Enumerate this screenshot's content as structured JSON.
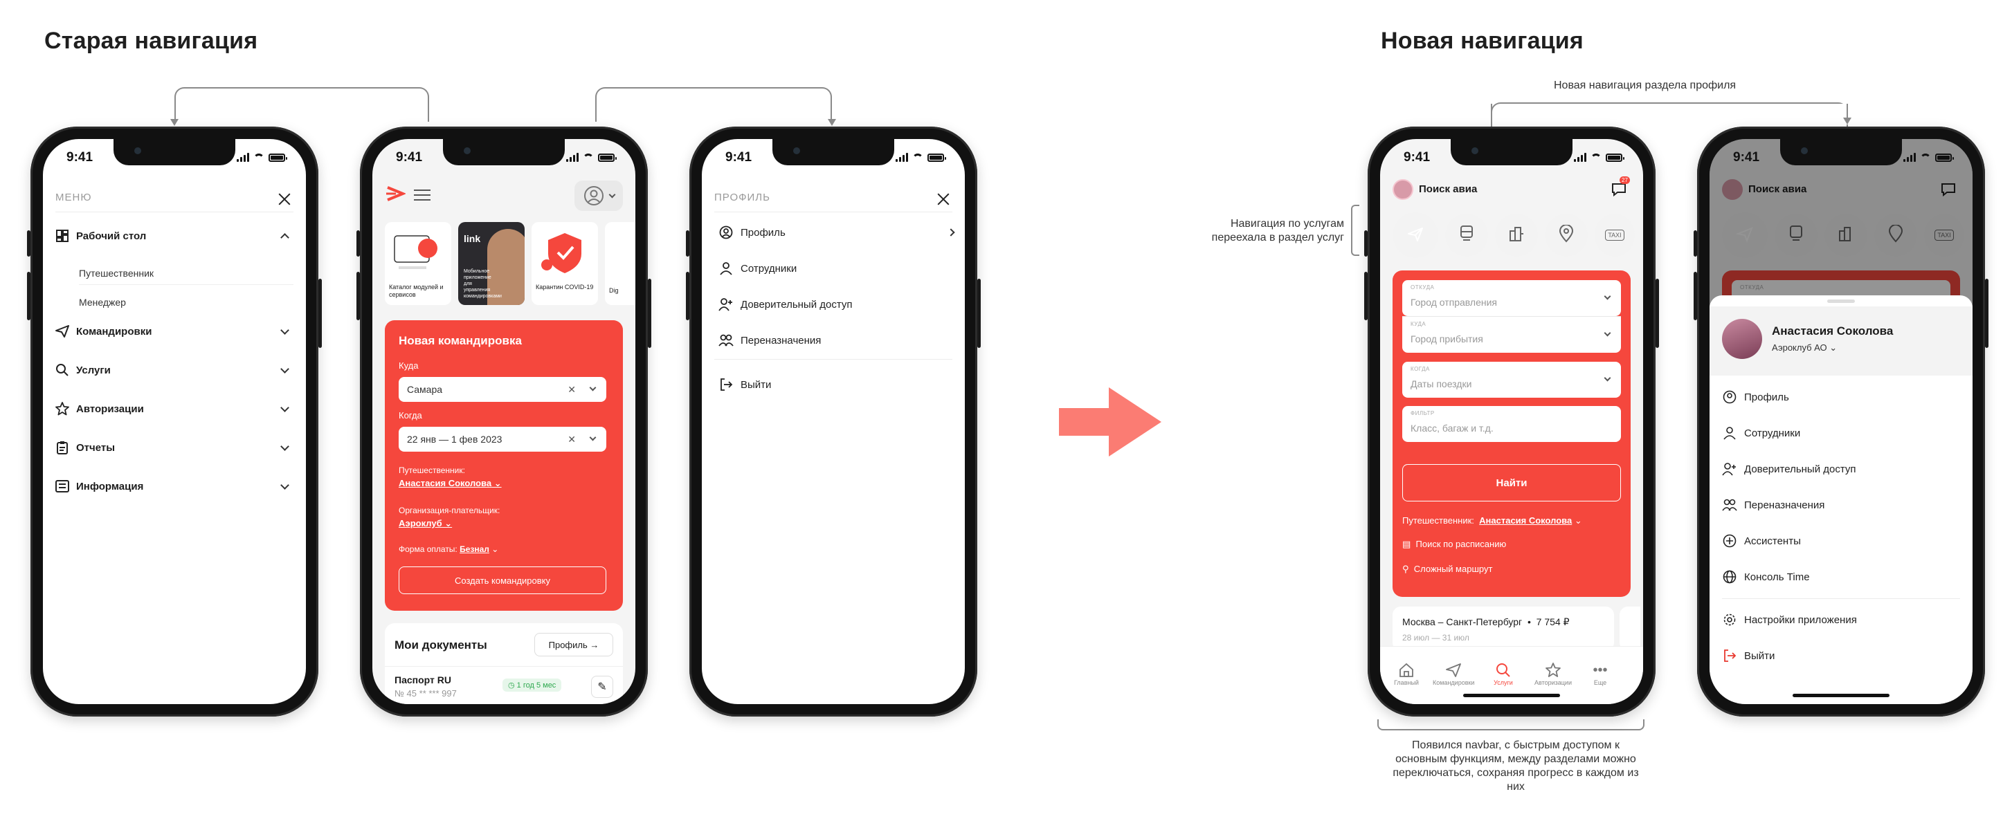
{
  "old_title": "Старая навигация",
  "new_title": "Новая навигация",
  "status_time": "9:41",
  "colors": {
    "accent": "#f5473d",
    "arrow": "#fb7c73"
  },
  "phone1": {
    "menu_label": "МЕНЮ",
    "items": [
      {
        "label": "Рабочий стол",
        "icon": "dashboard-icon"
      },
      {
        "label": "Командировки",
        "icon": "send-icon"
      },
      {
        "label": "Услуги",
        "icon": "search-icon"
      },
      {
        "label": "Авторизации",
        "icon": "star-icon"
      },
      {
        "label": "Отчеты",
        "icon": "clipboard-icon"
      },
      {
        "label": "Информация",
        "icon": "info-list-icon"
      }
    ],
    "sub_active": "Путешественник",
    "sub_other": "Менеджер"
  },
  "phone2": {
    "stories": [
      "Каталог модулей и сервисов",
      "Мобильное приложение для управления командировками",
      "Карантин COVID-19",
      "Dig"
    ],
    "story_link": "link",
    "card_title": "Новая командировка",
    "to_label": "Куда",
    "to_value": "Самара",
    "when_label": "Когда",
    "when_value": "22 янв — 1 фев 2023",
    "traveler_label": "Путешественник:",
    "traveler_value": "Анастасия Соколова",
    "org_label": "Организация-плательщик:",
    "org_value": "Аэроклуб",
    "pay_label": "Форма оплаты:",
    "pay_value": "Безнал",
    "create_btn": "Создать командировку",
    "docs_title": "Мои документы",
    "profile_btn": "Профиль",
    "passport_title": "Паспорт RU",
    "passport_number": "№ 45 ** *** 997",
    "passport_badge": "1 год 5 мес"
  },
  "phone3": {
    "header": "ПРОФИЛЬ",
    "items": [
      "Профиль",
      "Сотрудники",
      "Доверительный доступ",
      "Переназначения"
    ],
    "logout": "Выйти"
  },
  "phone4": {
    "header_title": "Поиск авиа",
    "badge": "27",
    "services": [
      "plane-icon",
      "train-icon",
      "hotel-icon",
      "location-icon",
      "taxi-icon"
    ],
    "taxi_text": "TAXI",
    "from_tag": "ОТКУДА",
    "from_ph": "Город отправления",
    "to_tag": "КУДА",
    "to_ph": "Город прибытия",
    "when_tag": "КОГДА",
    "when_ph": "Даты поездки",
    "extra_tag": "ФИЛЬТР",
    "extra_ph": "Класс, багаж и т.д.",
    "find_btn": "Найти",
    "traveler_label": "Путешественник:",
    "traveler_value": "Анастасия Соколова",
    "schedule_link": "Поиск по расписанию",
    "complex_link": "Сложный маршрут",
    "recent_route": "Москва – Санкт-Петербург",
    "recent_price": "7 754 ₽",
    "recent_dates": "28 июл — 31 июл",
    "nav": [
      "Главный",
      "Командировки",
      "Услуги",
      "Авторизации",
      "Еще"
    ]
  },
  "phone5": {
    "user_name": "Анастасия Соколова",
    "company": "Аэроклуб АО",
    "items": [
      "Профиль",
      "Сотрудники",
      "Доверительный доступ",
      "Переназначения",
      "Ассистенты",
      "Консоль Time"
    ],
    "settings": "Настройки приложения",
    "logout": "Выйти"
  },
  "callouts": {
    "profile_nav": "Новая навигация раздела профиля",
    "services_moved": "Навигация по услугам переехала в раздел услуг",
    "navbar_note": "Появился navbar, с быстрым доступом к основным функциям, между разделами можно переключаться, сохраняя прогресс в каждом из них"
  }
}
